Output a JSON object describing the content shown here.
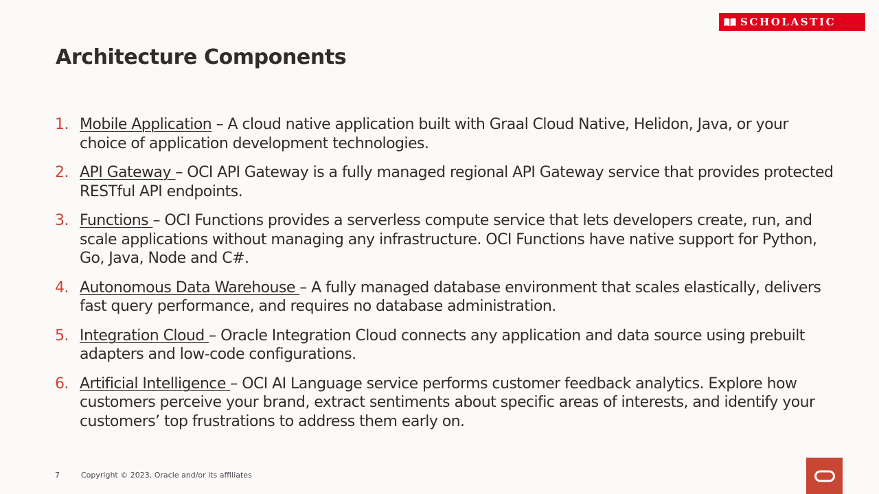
{
  "header": {
    "logo_text": "SCHOLASTIC",
    "title": "Architecture Components"
  },
  "items": [
    {
      "number": "1.",
      "term": "Mobile Application",
      "separator": " – ",
      "description": "A cloud native application built with Graal Cloud Native, Helidon, Java, or your choice of application development technologies."
    },
    {
      "number": "2.",
      "term": "API Gateway ",
      "separator": "– ",
      "description": "OCI API Gateway is a fully managed regional API Gateway service that provides protected RESTful API endpoints."
    },
    {
      "number": "3.",
      "term": "Functions ",
      "separator": "– ",
      "description": "OCI Functions provides a serverless compute service that lets developers create, run, and scale applications without managing any infrastructure.  OCI Functions have native support for Python, Go, Java, Node and C#."
    },
    {
      "number": "4.",
      "term": "Autonomous Data Warehouse ",
      "separator": "– ",
      "description": "A fully managed database environment that scales elastically, delivers fast query performance, and requires no database administration."
    },
    {
      "number": "5.",
      "term": "Integration Cloud ",
      "separator": "– ",
      "description": "Oracle Integration Cloud connects any application and data source using prebuilt adapters and low-code configurations."
    },
    {
      "number": "6.",
      "term": "Artificial Intelligence ",
      "separator": "– ",
      "description": "OCI AI Language service performs customer feedback analytics.  Explore how customers perceive your brand, extract sentiments about specific areas of interests, and identify your customers’ top frustrations to address them early on."
    }
  ],
  "footer": {
    "page_number": "7",
    "copyright": "Copyright © 2023, Oracle and/or its affiliates"
  },
  "icons": {
    "scholastic_book": "open-book-icon",
    "oracle_logo": "oracle-logo-icon"
  },
  "colors": {
    "background": "#fbfaf9",
    "text": "#312d2a",
    "accent_number": "#c74634",
    "scholastic_red": "#e3001b",
    "oracle_red": "#c74634"
  }
}
